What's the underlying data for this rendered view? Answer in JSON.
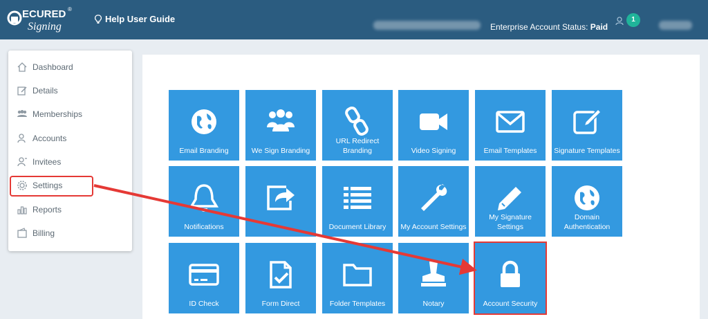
{
  "header": {
    "logo_text": "SECURED Signing",
    "help_label": "Help User Guide",
    "status_label": "Enterprise Account Status:",
    "status_value": "Paid",
    "notification_count": "1"
  },
  "sidebar": {
    "items": [
      {
        "label": "Dashboard",
        "icon": "home-icon"
      },
      {
        "label": "Details",
        "icon": "edit-icon"
      },
      {
        "label": "Memberships",
        "icon": "group-icon"
      },
      {
        "label": "Accounts",
        "icon": "account-icon"
      },
      {
        "label": "Invitees",
        "icon": "invitee-icon"
      },
      {
        "label": "Settings",
        "icon": "gear-icon"
      },
      {
        "label": "Reports",
        "icon": "bar-chart-icon"
      },
      {
        "label": "Billing",
        "icon": "wallet-icon"
      }
    ]
  },
  "tiles": [
    {
      "label": "Email Branding",
      "icon": "globe-icon"
    },
    {
      "label": "We Sign Branding",
      "icon": "users-icon"
    },
    {
      "label": "URL Redirect Branding",
      "icon": "link-icon"
    },
    {
      "label": "Video Signing",
      "icon": "video-camera-icon"
    },
    {
      "label": "Email Templates",
      "icon": "envelope-icon"
    },
    {
      "label": "Signature Templates",
      "icon": "signature-edit-icon"
    },
    {
      "label": "Notifications",
      "icon": "bell-icon"
    },
    {
      "label": "",
      "icon": "share-icon"
    },
    {
      "label": "Document Library",
      "icon": "list-icon"
    },
    {
      "label": "My Account Settings",
      "icon": "wrench-icon"
    },
    {
      "label": "My Signature Settings",
      "icon": "pencil-icon"
    },
    {
      "label": "Domain Authentication",
      "icon": "globe-icon"
    },
    {
      "label": "ID Check",
      "icon": "credit-card-icon"
    },
    {
      "label": "Form Direct",
      "icon": "form-check-icon"
    },
    {
      "label": "Folder Templates",
      "icon": "folder-icon"
    },
    {
      "label": "Notary",
      "icon": "stamp-icon"
    },
    {
      "label": "Account Security",
      "icon": "lock-icon"
    }
  ],
  "colors": {
    "topbar": "#2b5c80",
    "tile": "#3399e0",
    "annotation": "#e53935",
    "badge": "#20b49a"
  }
}
